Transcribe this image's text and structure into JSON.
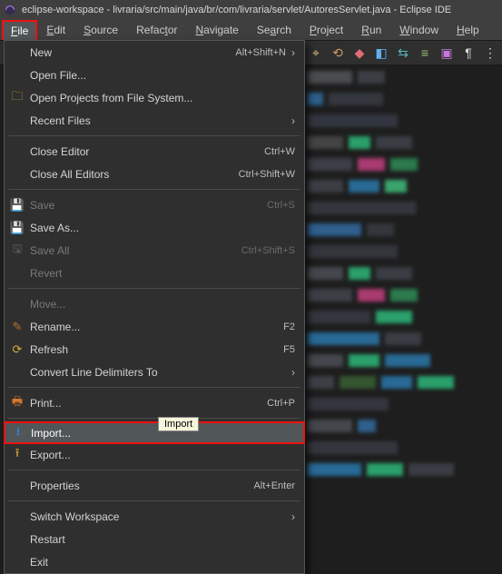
{
  "title": "eclipse-workspace - livraria/src/main/java/br/com/livraria/servlet/AutoresServlet.java - Eclipse IDE",
  "menubar": {
    "file": {
      "pre": "",
      "u": "F",
      "post": "ile"
    },
    "edit": {
      "pre": "",
      "u": "E",
      "post": "dit"
    },
    "source": {
      "pre": "",
      "u": "S",
      "post": "ource"
    },
    "refactor": {
      "pre": "Refac",
      "u": "t",
      "post": "or"
    },
    "navigate": {
      "pre": "",
      "u": "N",
      "post": "avigate"
    },
    "search": {
      "pre": "Se",
      "u": "a",
      "post": "rch"
    },
    "project": {
      "pre": "",
      "u": "P",
      "post": "roject"
    },
    "run": {
      "pre": "",
      "u": "R",
      "post": "un"
    },
    "window": {
      "pre": "",
      "u": "W",
      "post": "indow"
    },
    "help": {
      "pre": "",
      "u": "H",
      "post": "elp"
    }
  },
  "dropdown": {
    "new": {
      "label": "New",
      "shortcut": "Alt+Shift+N",
      "sub": "›"
    },
    "open_file": {
      "label": "Open File..."
    },
    "open_projects": {
      "label": "Open Projects from File System..."
    },
    "recent_files": {
      "label": "Recent Files",
      "sub": "›"
    },
    "close_editor": {
      "label": "Close Editor",
      "shortcut": "Ctrl+W"
    },
    "close_all": {
      "label": "Close All Editors",
      "shortcut": "Ctrl+Shift+W"
    },
    "save": {
      "label": "Save",
      "shortcut": "Ctrl+S"
    },
    "save_as": {
      "label": "Save As..."
    },
    "save_all": {
      "label": "Save All",
      "shortcut": "Ctrl+Shift+S"
    },
    "revert": {
      "label": "Revert"
    },
    "move": {
      "label": "Move..."
    },
    "rename": {
      "label": "Rename...",
      "shortcut": "F2"
    },
    "refresh": {
      "label": "Refresh",
      "shortcut": "F5"
    },
    "convert_delims": {
      "label": "Convert Line Delimiters To",
      "sub": "›"
    },
    "print": {
      "label": "Print...",
      "shortcut": "Ctrl+P"
    },
    "import": {
      "label": "Import...",
      "tooltip": "Import"
    },
    "export": {
      "label": "Export..."
    },
    "properties": {
      "label": "Properties",
      "shortcut": "Alt+Enter"
    },
    "switch_ws": {
      "label": "Switch Workspace",
      "sub": "›"
    },
    "restart": {
      "label": "Restart"
    },
    "exit": {
      "label": "Exit"
    }
  }
}
